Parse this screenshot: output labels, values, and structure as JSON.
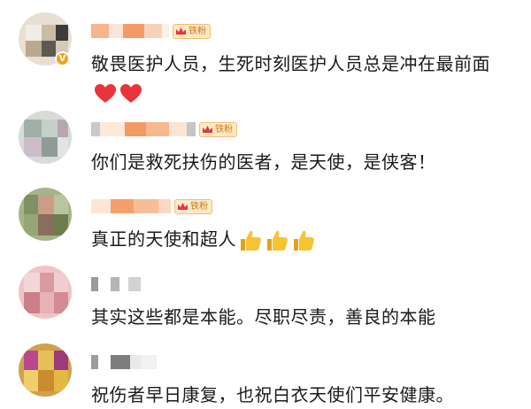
{
  "fan_badge_label": "铁粉",
  "comments": [
    {
      "text": "敬畏医护人员，生死时刻医护人员总是冲在最前面",
      "has_fan_badge": true,
      "verified": true,
      "emojis": [
        "heart-emoji",
        "heart-emoji"
      ]
    },
    {
      "text": "你们是救死扶伤的医者，是天使，是侠客！",
      "has_fan_badge": true,
      "verified": false,
      "emojis": []
    },
    {
      "text": "真正的天使和超人",
      "has_fan_badge": true,
      "verified": false,
      "emojis": [
        "thumbs-up-emoji",
        "thumbs-up-emoji",
        "thumbs-up-emoji"
      ]
    },
    {
      "text": "其实这些都是本能。尽职尽责，善良的本能",
      "has_fan_badge": false,
      "verified": false,
      "emojis": []
    },
    {
      "text": "祝伤者早日康复，也祝白衣天使们平安健康。",
      "has_fan_badge": false,
      "verified": false,
      "emojis": []
    }
  ],
  "colors": {
    "text": "#1a1a1a",
    "badge_bg": "#fbe9c8",
    "badge_border": "#f1c071",
    "badge_text": "#d27a12",
    "verified": "#f3a11c",
    "heart": "#e8343a",
    "thumb": "#f7c234"
  }
}
